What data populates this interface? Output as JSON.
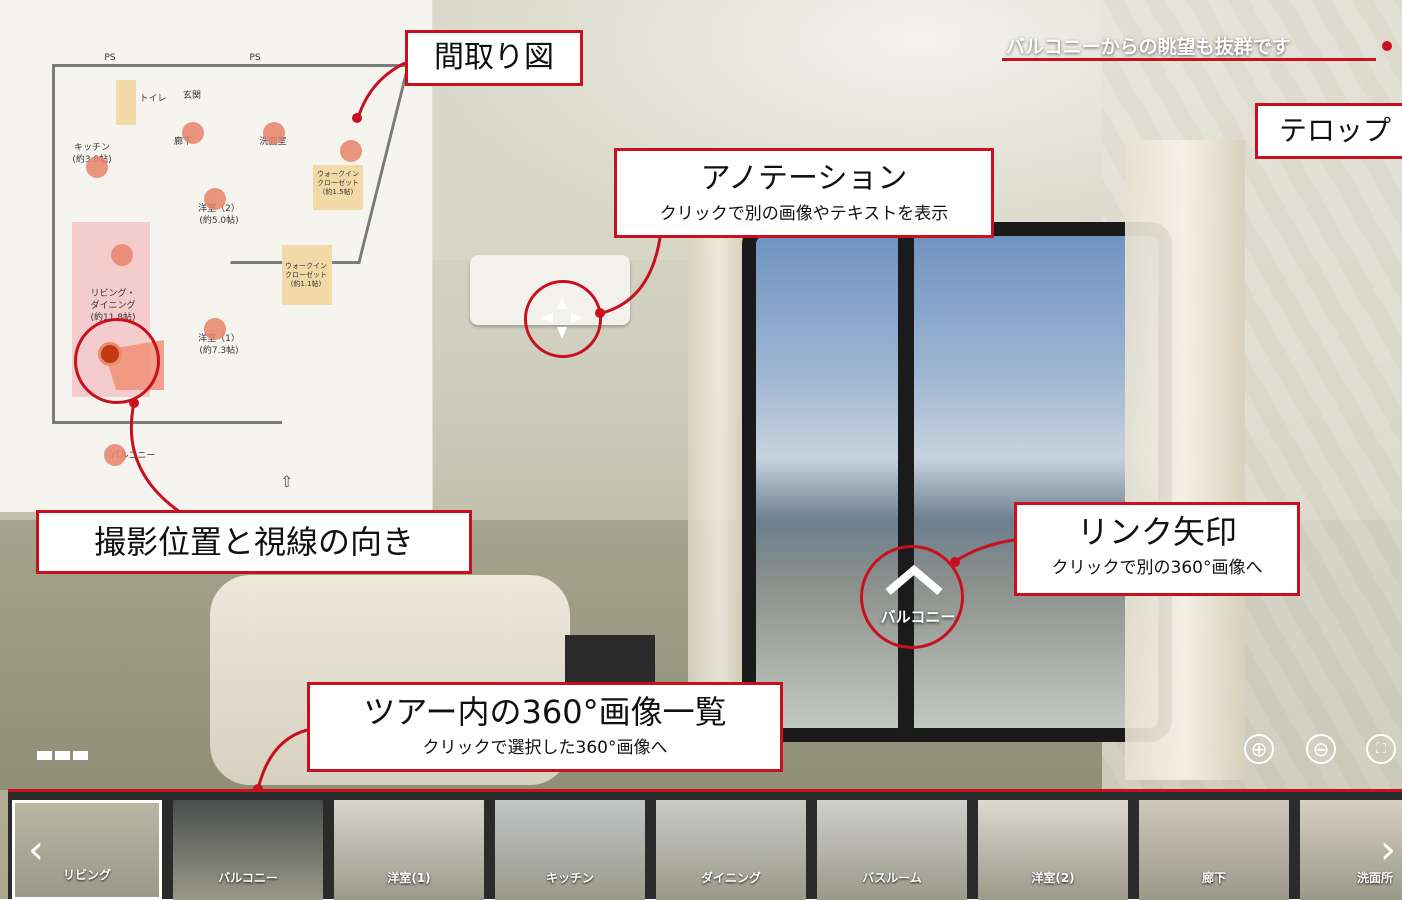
{
  "viewer": {
    "telop_text": "バルコニーからの眺望も抜群です",
    "link_arrow_label": "バルコニー"
  },
  "callouts": {
    "floorplan": {
      "title": "間取り図"
    },
    "telop": {
      "title": "テロップ"
    },
    "annotation": {
      "title": "アノテーション",
      "subtitle": "クリックで別の画像やテキストを表示"
    },
    "shooting_position": {
      "title": "撮影位置と視線の向き"
    },
    "link_arrow": {
      "title": "リンク矢印",
      "subtitle": "クリックで別の360°画像へ"
    },
    "tour_list": {
      "title": "ツアー内の360°画像一覧",
      "subtitle": "クリックで選択した360°画像へ"
    }
  },
  "floorplan": {
    "labels": {
      "ps_left": "PS",
      "ps_right": "PS",
      "toilet": "トイレ",
      "entrance": "玄関",
      "kitchen": "キッチン\n(約3.8帖)",
      "hallway": "廊下",
      "washroom": "洗面室",
      "western1": "洋室（2）\n(約5.0帖)",
      "western2": "洋室（1）\n(約7.3帖)",
      "living": "リビング・\nダイニング\n(約11.8帖)",
      "balcony": "バルコニー",
      "walkin1": "ウォークイン\nクローゼット\n(約1.5帖)",
      "walkin2": "ウォークイン\nクローゼット\n(約1.1帖)"
    }
  },
  "controls": {
    "zoom_in": "⊕",
    "zoom_out": "⊖",
    "fullscreen": "⛶",
    "prev": "‹",
    "next": "›"
  },
  "thumbnails": [
    {
      "label": "リビング",
      "color": "#b8b7a3",
      "active": true
    },
    {
      "label": "バルコニー",
      "color": "#4a4d4c",
      "active": false
    },
    {
      "label": "洋室(1)",
      "color": "#d9d6cf",
      "active": false
    },
    {
      "label": "キッチン",
      "color": "#c1c5c6",
      "active": false
    },
    {
      "label": "ダイニング",
      "color": "#c9cbc6",
      "active": false
    },
    {
      "label": "バスルーム",
      "color": "#cfd0cd",
      "active": false
    },
    {
      "label": "洋室(2)",
      "color": "#dcd9d1",
      "active": false
    },
    {
      "label": "廊下",
      "color": "#cdc8bc",
      "active": false
    },
    {
      "label": "洗面所",
      "color": "#d5d1c4",
      "active": false
    }
  ],
  "colors": {
    "accent": "#c8101e"
  }
}
